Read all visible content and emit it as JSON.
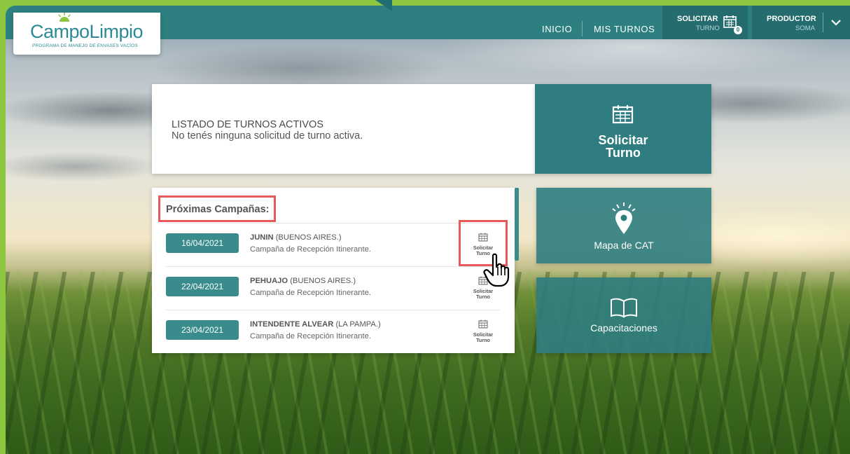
{
  "brand": {
    "name": "CampoLimpio",
    "tagline": "PROGRAMA DE MANEJO DE ENVASES VACÍOS"
  },
  "nav": {
    "inicio": "INICIO",
    "mis_turnos": "MIS TURNOS",
    "solicitar_title": "SOLICITAR",
    "solicitar_sub": "TURNO",
    "turno_count": "0",
    "user_title": "PRODUCTOR",
    "user_sub": "SOMA"
  },
  "turnos": {
    "title": "LISTADO DE TURNOS ACTIVOS",
    "message": "No tenés ninguna solicitud de turno activa."
  },
  "solicitar_card": {
    "line1": "Solicitar",
    "line2": "Turno"
  },
  "mapa_card": {
    "label": "Mapa de CAT"
  },
  "capacitaciones_card": {
    "label": "Capacitaciones"
  },
  "campanas": {
    "title": "Próximas Campañas:",
    "action_line1": "Solicitar",
    "action_line2": "Turno",
    "items": [
      {
        "date": "16/04/2021",
        "city": "JUNIN",
        "province": "(BUENOS AIRES.)",
        "desc": "Campaña de Recepción Itinerante."
      },
      {
        "date": "22/04/2021",
        "city": "PEHUAJO",
        "province": "(BUENOS AIRES.)",
        "desc": "Campaña de Recepción Itinerante."
      },
      {
        "date": "23/04/2021",
        "city": "INTENDENTE ALVEAR",
        "province": "(LA PAMPA.)",
        "desc": "Campaña de Recepción Itinerante."
      }
    ]
  },
  "colors": {
    "frame": "#8dc63f",
    "teal": "#2e8080",
    "highlight": "#e8595a"
  }
}
